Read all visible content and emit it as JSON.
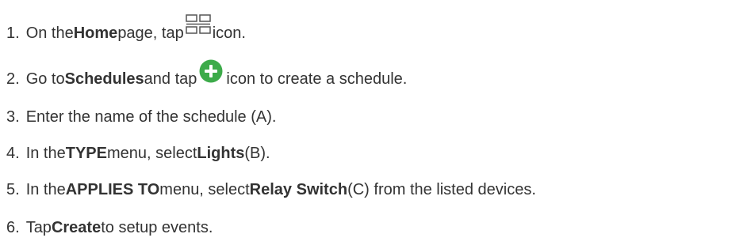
{
  "steps": [
    {
      "num": "1.",
      "parts": [
        "On the ",
        "Home",
        " page, tap ",
        " icon."
      ],
      "icon": "grid-icon"
    },
    {
      "num": "2.",
      "parts": [
        "Go to ",
        "Schedules",
        " and tap ",
        " icon to create a schedule."
      ],
      "icon": "plus-circle-icon"
    },
    {
      "num": "3.",
      "parts": [
        "Enter the name of the schedule (A)."
      ]
    },
    {
      "num": "4.",
      "parts": [
        "In the ",
        "TYPE",
        " menu, select ",
        "Lights",
        " (B)."
      ]
    },
    {
      "num": "5.",
      "parts": [
        "In the ",
        "APPLIES TO",
        " menu, select ",
        "Relay Switch",
        " (C) from the listed devices."
      ]
    },
    {
      "num": "6.",
      "parts": [
        "Tap ",
        "Create",
        " to setup events."
      ]
    }
  ],
  "colors": {
    "text": "#333333",
    "icon_green": "#3dab4a",
    "icon_gray": "#555555"
  }
}
